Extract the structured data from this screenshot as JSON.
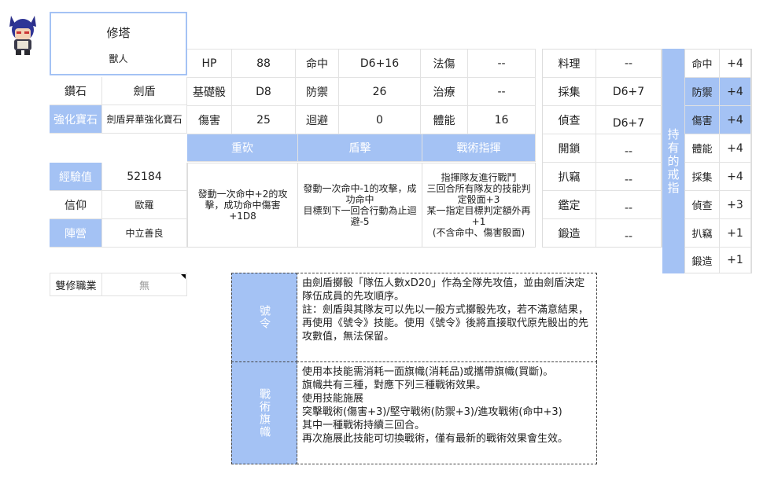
{
  "profile": {
    "name": "修塔",
    "race": "獸人"
  },
  "left_info": {
    "ore_label": "鑽石",
    "ore_value": "劍盾",
    "gem_label": "強化寶石",
    "gem_value": "劍盾昇華強化寶石",
    "exp_label": "經驗值",
    "exp_value": "52184",
    "faith_label": "信仰",
    "faith_value": "歐羅",
    "camp_label": "陣營",
    "camp_value": "中立善良",
    "dual_label": "雙修職業",
    "dual_value": "無"
  },
  "stats": {
    "hp_label": "HP",
    "hp_value": "88",
    "hit_label": "命中",
    "hit_value": "D6+16",
    "magic_label": "法傷",
    "magic_value": "--",
    "base_label": "基礎骰",
    "base_value": "D8",
    "def_label": "防禦",
    "def_value": "26",
    "heal_label": "治療",
    "heal_value": "--",
    "dmg_label": "傷害",
    "dmg_value": "25",
    "eva_label": "迴避",
    "eva_value": "0",
    "stam_label": "體能",
    "stam_value": "16"
  },
  "skills": [
    {
      "name": "重砍",
      "desc": "發動一次命中+2的攻擊，成功命中傷害+1D8"
    },
    {
      "name": "盾擊",
      "desc": "發動一次命中-1的攻擊，成功命中\n目標到下一回合行動為止迴避-5"
    },
    {
      "name": "戰術指揮",
      "desc": "指揮隊友進行戰鬥\n三回合所有隊友的技能判定骰面+3\n某一指定目標判定額外再+1\n(不含命中、傷害骰面)"
    }
  ],
  "life_skills": [
    {
      "label": "料理",
      "value": "--"
    },
    {
      "label": "採集",
      "value": "D6+7"
    },
    {
      "label": "偵查",
      "value": "D6+7"
    },
    {
      "label": "開鎖",
      "value": "--"
    },
    {
      "label": "扒竊",
      "value": "--"
    },
    {
      "label": "鑑定",
      "value": "--"
    },
    {
      "label": "鍛造",
      "value": "--"
    }
  ],
  "ring": {
    "title": "持有的戒指",
    "rows": [
      {
        "label": "命中",
        "value": "+4",
        "highlight": false
      },
      {
        "label": "防禦",
        "value": "+4",
        "highlight": true
      },
      {
        "label": "傷害",
        "value": "+4",
        "highlight": true
      },
      {
        "label": "體能",
        "value": "+4",
        "highlight": false
      },
      {
        "label": "採集",
        "value": "+4",
        "highlight": false
      },
      {
        "label": "偵查",
        "value": "+3",
        "highlight": false
      },
      {
        "label": "扒竊",
        "value": "+1",
        "highlight": false
      },
      {
        "label": "鍛造",
        "value": "+1",
        "highlight": false
      }
    ]
  },
  "passives": [
    {
      "name": "號令",
      "desc": "由劍盾擲骰「隊伍人數xD20」作為全隊先攻值，並由劍盾決定隊伍成員的先攻順序。\n註：劍盾與其隊友可以先以一般方式擲骰先攻，若不滿意結果，再使用《號令》技能。使用《號令》後將直接取代原先骰出的先攻數值，無法保留。"
    },
    {
      "name": "戰術旗幟",
      "desc": "使用本技能需消耗一面旗幟(消耗品)或攜帶旗幟(買斷)。\n旗幟共有三種，對應下列三種戰術效果。\n使用技能施展\n突擊戰術(傷害+3)/堅守戰術(防禦+3)/進攻戰術(命中+3)\n其中一種戰術持續三回合。\n再次施展此技能可切換戰術，僅有最新的戰術效果會生效。"
    }
  ],
  "colors": {
    "accent": "#a4c2f4",
    "highlight": "#a4c2f4"
  }
}
